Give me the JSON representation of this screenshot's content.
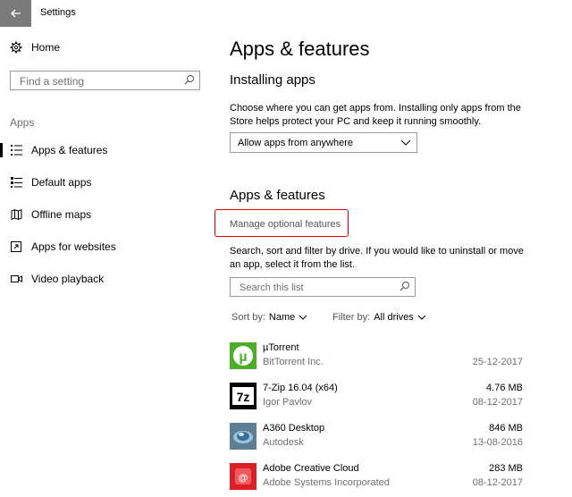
{
  "window": {
    "title": "Settings"
  },
  "sidebar": {
    "home_label": "Home",
    "search_placeholder": "Find a setting",
    "section_label": "Apps",
    "items": [
      {
        "label": "Apps & features",
        "icon": "list-icon"
      },
      {
        "label": "Default apps",
        "icon": "default-apps-icon"
      },
      {
        "label": "Offline maps",
        "icon": "map-icon"
      },
      {
        "label": "Apps for websites",
        "icon": "open-link-icon"
      },
      {
        "label": "Video playback",
        "icon": "video-icon"
      }
    ]
  },
  "main": {
    "title": "Apps & features",
    "installing": {
      "heading": "Installing apps",
      "description": "Choose where you can get apps from. Installing only apps from the Store helps protect your PC and keep it running smoothly.",
      "dropdown_value": "Allow apps from anywhere"
    },
    "features": {
      "heading": "Apps & features",
      "manage_link": "Manage optional features",
      "description": "Search, sort and filter by drive. If you would like to uninstall or move an app, select it from the list.",
      "search_placeholder": "Search this list",
      "sort_label": "Sort by:",
      "sort_value": "Name",
      "filter_label": "Filter by:",
      "filter_value": "All drives"
    },
    "apps": [
      {
        "name": "µTorrent",
        "publisher": "BitTorrent Inc.",
        "size": "",
        "date": "25-12-2017",
        "icon_color": "#4caf28"
      },
      {
        "name": "7-Zip 16.04 (x64)",
        "publisher": "Igor Pavlov",
        "size": "4.76 MB",
        "date": "08-12-2017",
        "icon_color": "#000000"
      },
      {
        "name": "A360 Desktop",
        "publisher": "Autodesk",
        "size": "846 MB",
        "date": "13-08-2016",
        "icon_color": "#3a6f9a"
      },
      {
        "name": "Adobe Creative Cloud",
        "publisher": "Adobe Systems Incorporated",
        "size": "283 MB",
        "date": "08-12-2017",
        "icon_color": "#da1f26"
      }
    ]
  }
}
